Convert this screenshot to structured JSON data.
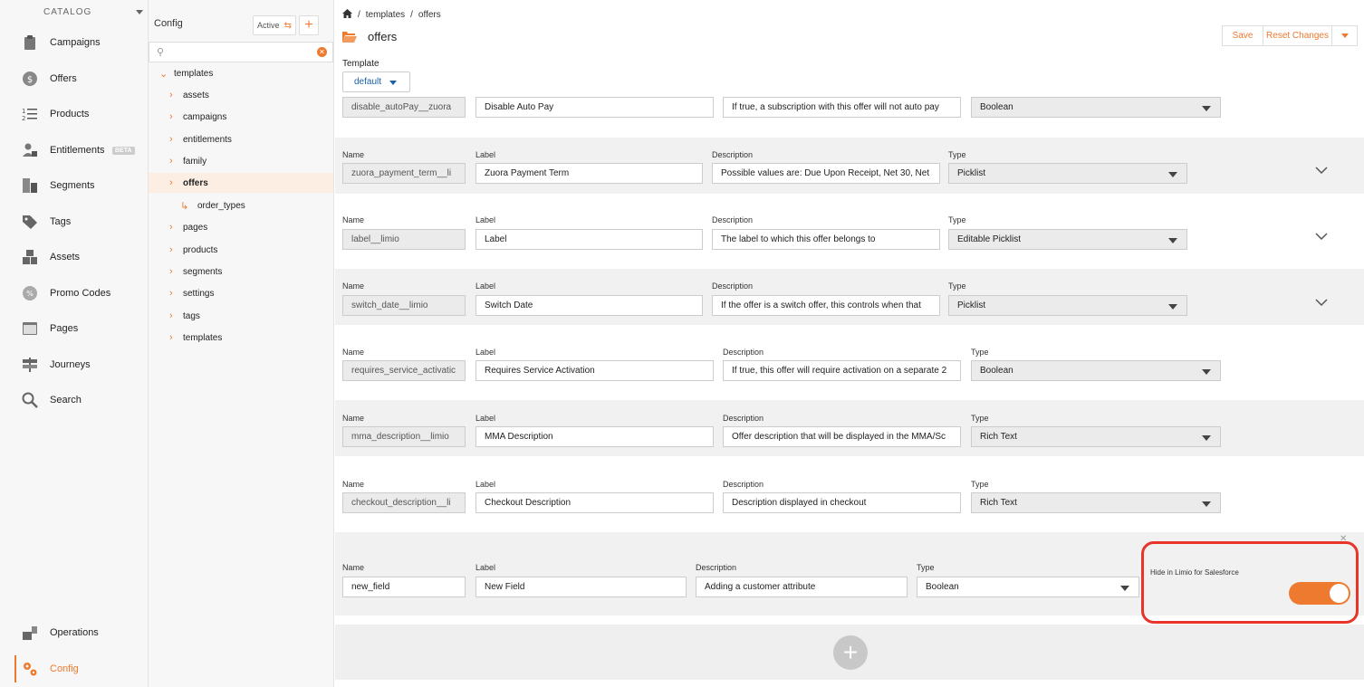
{
  "nav": {
    "catalog_label": "CATALOG",
    "items": [
      {
        "label": "Campaigns"
      },
      {
        "label": "Offers"
      },
      {
        "label": "Products"
      },
      {
        "label": "Entitlements",
        "badge": "BETA"
      },
      {
        "label": "Segments"
      },
      {
        "label": "Tags"
      },
      {
        "label": "Assets"
      },
      {
        "label": "Promo Codes"
      },
      {
        "label": "Pages"
      },
      {
        "label": "Journeys"
      },
      {
        "label": "Search"
      }
    ],
    "bottom": [
      {
        "label": "Operations"
      },
      {
        "label": "Config"
      }
    ]
  },
  "tree": {
    "title": "Config",
    "active_label": "Active",
    "search_value": "",
    "nodes": [
      {
        "label": "templates"
      },
      {
        "label": "assets"
      },
      {
        "label": "campaigns"
      },
      {
        "label": "entitlements"
      },
      {
        "label": "family"
      },
      {
        "label": "offers"
      },
      {
        "label": "order_types"
      },
      {
        "label": "pages"
      },
      {
        "label": "products"
      },
      {
        "label": "segments"
      },
      {
        "label": "settings"
      },
      {
        "label": "tags"
      },
      {
        "label": "templates"
      }
    ]
  },
  "breadcrumb": {
    "sep": "/",
    "items": [
      "templates",
      "offers"
    ]
  },
  "page_title": "offers",
  "buttons": {
    "save": "Save",
    "reset": "Reset Changes"
  },
  "template": {
    "label": "Template",
    "value": "default"
  },
  "field_labels": {
    "name": "Name",
    "label": "Label",
    "description": "Description",
    "type": "Type"
  },
  "rows": [
    {
      "name": "disable_autoPay__zuora",
      "label": "Disable Auto Pay",
      "description": "If true, a subscription with this offer will not auto pay",
      "type": "Boolean"
    },
    {
      "name": "zuora_payment_term__li",
      "label": "Zuora Payment Term",
      "description": "Possible values are: Due Upon Receipt, Net 30, Net",
      "type": "Picklist"
    },
    {
      "name": "label__limio",
      "label": "Label",
      "description": "The label to which this offer belongs to",
      "type": "Editable Picklist"
    },
    {
      "name": "switch_date__limio",
      "label": "Switch Date",
      "description": "If the offer is a switch offer, this controls when that",
      "type": "Picklist"
    },
    {
      "name": "requires_service_activatic",
      "label": "Requires Service Activation",
      "description": "If true, this offer will require activation on a separate 2",
      "type": "Boolean"
    },
    {
      "name": "mma_description__limio",
      "label": "MMA Description",
      "description": "Offer description that will be displayed in the MMA/Sc",
      "type": "Rich Text"
    },
    {
      "name": "checkout_description__li",
      "label": "Checkout Description",
      "description": "Description displayed in checkout",
      "type": "Rich Text"
    },
    {
      "name": "new_field",
      "label": "New Field",
      "description": "Adding a customer attribute",
      "type": "Boolean"
    }
  ],
  "hide_option": {
    "label": "Hide in Limio for Salesforce",
    "enabled": true
  },
  "colors": {
    "accent": "#ee7a2f",
    "highlight": "#e8352a"
  }
}
